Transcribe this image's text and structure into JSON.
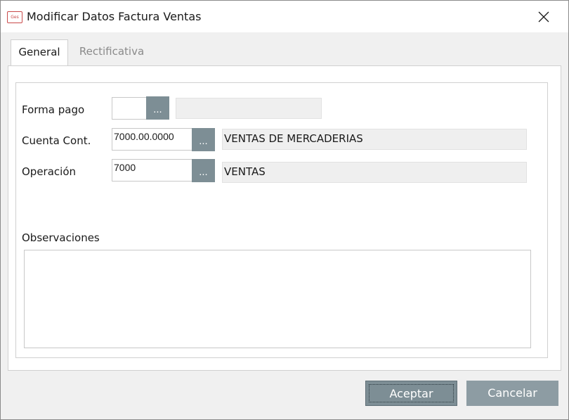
{
  "window": {
    "title": "Modificar Datos Factura Ventas",
    "icon_label": "Ges"
  },
  "tabs": [
    {
      "label": "General",
      "active": true
    },
    {
      "label": "Rectificativa",
      "active": false
    }
  ],
  "form": {
    "forma_pago": {
      "label": "Forma pago",
      "value": "",
      "description": ""
    },
    "cuenta_cont": {
      "label": "Cuenta Cont.",
      "value": "7000.00.0000",
      "description": "VENTAS DE MERCADERIAS"
    },
    "operacion": {
      "label": "Operación",
      "value": "7000",
      "description": "VENTAS"
    },
    "browse_label": "...",
    "observaciones": {
      "label": "Observaciones",
      "value": ""
    }
  },
  "buttons": {
    "accept": "Aceptar",
    "cancel": "Cancelar"
  },
  "colors": {
    "button_bg": "#7d8e95",
    "desc_bg": "#efefef"
  }
}
